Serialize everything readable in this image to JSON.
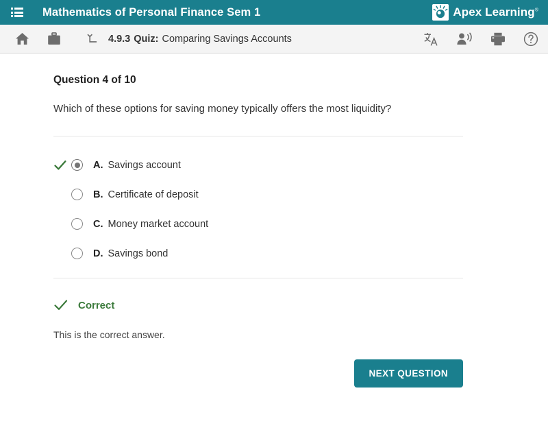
{
  "header": {
    "menu_icon": "list-menu-icon",
    "course_title": "Mathematics of Personal Finance Sem 1",
    "brand_name": "Apex Learning",
    "brand_tm": "®",
    "brand_logo_icon": "apex-lightbulb-logo-icon",
    "accent_color": "#1a7f8e"
  },
  "toolbar": {
    "home_icon": "home-icon",
    "briefcase_icon": "briefcase-icon",
    "up_level_icon": "up-level-arrow-icon",
    "lesson_number": "4.9.3",
    "activity_type": "Quiz:",
    "activity_name": "Comparing Savings Accounts",
    "translate_icon": "translate-icon",
    "read_aloud_icon": "read-aloud-icon",
    "print_icon": "print-icon",
    "help_icon": "help-icon"
  },
  "question": {
    "heading": "Question 4 of 10",
    "prompt": "Which of these options for saving money typically offers the most liquidity?",
    "options": [
      {
        "letter": "A.",
        "label": "Savings account",
        "selected": true,
        "correct": true
      },
      {
        "letter": "B.",
        "label": "Certificate of deposit",
        "selected": false,
        "correct": false
      },
      {
        "letter": "C.",
        "label": "Money market account",
        "selected": false,
        "correct": false
      },
      {
        "letter": "D.",
        "label": "Savings bond",
        "selected": false,
        "correct": false
      }
    ]
  },
  "feedback": {
    "check_icon": "check-mark-icon",
    "title": "Correct",
    "body": "This is the correct answer.",
    "color": "#3b7a3b"
  },
  "footer": {
    "next_label": "NEXT QUESTION"
  }
}
